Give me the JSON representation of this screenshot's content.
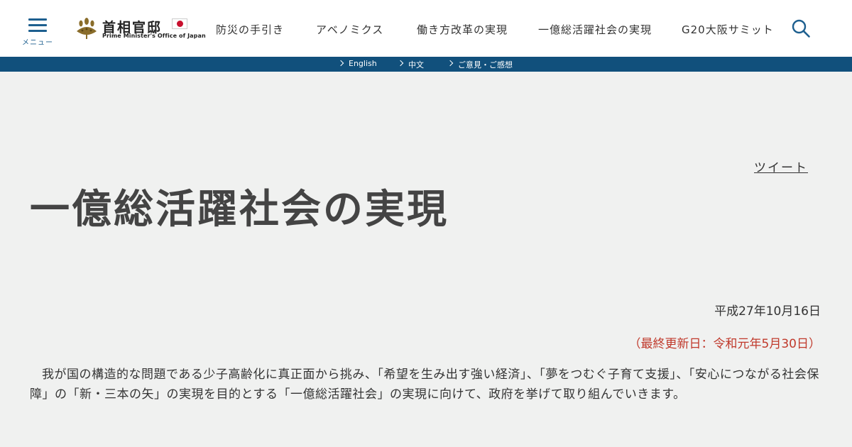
{
  "header": {
    "menu_label": "メニュー",
    "logo_jp": "首相官邸",
    "logo_en": "Prime Minister's Office of Japan",
    "nav": [
      "防災の手引き",
      "アベノミクス",
      "働き方改革の実現",
      "一億総活躍社会の実現",
      "G20大阪サミット"
    ],
    "search_icon": "search-icon"
  },
  "lang_bar": {
    "links": [
      "English",
      "中文",
      "ご意見・ご感想"
    ]
  },
  "article": {
    "tweet": "ツイート",
    "title": "一億総活躍社会の実現",
    "date": "平成27年10月16日",
    "updated": "（最終更新日：令和元年5月30日）",
    "body": "我が国の構造的な問題である少子高齢化に真正面から挑み、「希望を生み出す強い経済」、「夢をつむぐ子育て支援」、「安心につながる社会保障」の「新・三本の矢」の実現を目的とする「一億総活躍社会」の実現に向けて、政府を挙げて取り組んでいきます。"
  },
  "colors": {
    "accent": "#1d5f8f",
    "lang_bar": "#11507c",
    "updated_text": "#c0392b",
    "background": "#f0f1f0"
  }
}
